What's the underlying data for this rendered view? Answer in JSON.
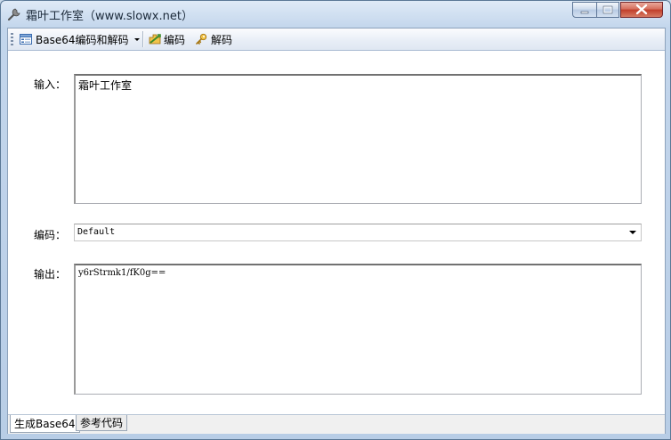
{
  "window": {
    "title": "霜叶工作室（www.slowx.net）"
  },
  "toolbar": {
    "dropdown_label": "Base64编码和解码",
    "encode_label": "编码",
    "decode_label": "解码"
  },
  "form": {
    "input_label": "输入：",
    "input_value": "霜叶工作室",
    "encoding_label": "编码：",
    "encoding_value": "Default",
    "output_label": "输出：",
    "output_value": "y6rStrmk1/fK0g=="
  },
  "tabs": [
    {
      "label": "生成Base64",
      "active": true
    },
    {
      "label": "参考代码",
      "active": false
    }
  ],
  "icons": {
    "title_icon": "tools-icon",
    "dropdown_icon": "form-icon",
    "encode_icon": "encode-icon",
    "decode_icon": "key-icon"
  }
}
